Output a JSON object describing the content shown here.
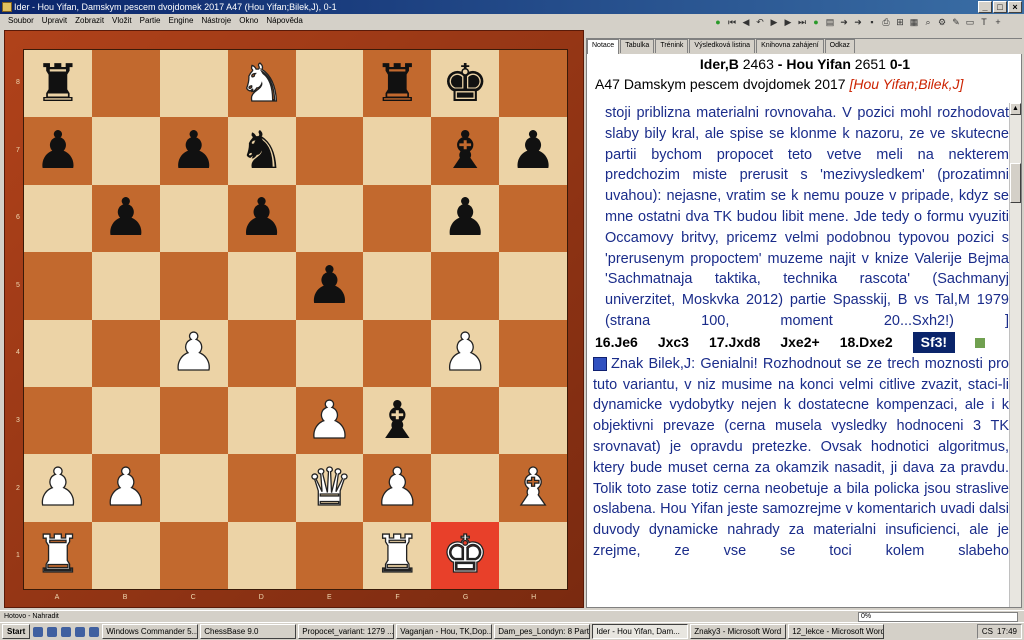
{
  "window": {
    "title": "Ider - Hou Yifan, Damskym pescem dvojdomek 2017  A47  (Hou Yifan;Bilek,J), 0-1"
  },
  "menu": [
    "Soubor",
    "Upravit",
    "Zobrazit",
    "Vložit",
    "Partie",
    "Engine",
    "Nástroje",
    "Okno",
    "Nápověda"
  ],
  "toolbar_icons": [
    "green-go-icon",
    "first-icon",
    "prev-icon",
    "undo-icon",
    "play-icon",
    "next-icon",
    "last-icon",
    "green-go-icon",
    "doc-icon",
    "arrow-icon",
    "arrow-icon",
    "save-icon",
    "print-icon",
    "tree-icon",
    "db-icon",
    "find-icon",
    "engine-icon",
    "edit-icon",
    "clipboard-icon",
    "text-icon",
    "plus-icon"
  ],
  "board": {
    "ranks": [
      "8",
      "7",
      "6",
      "5",
      "4",
      "3",
      "2",
      "1"
    ],
    "files": [
      "A",
      "B",
      "C",
      "D",
      "E",
      "F",
      "G",
      "H"
    ],
    "rows": [
      [
        "r",
        "",
        "",
        "N",
        "",
        "r",
        "k",
        ""
      ],
      [
        "p",
        "",
        "p",
        "n",
        "",
        "",
        "b",
        "p"
      ],
      [
        "",
        "p",
        "",
        "p",
        "",
        "",
        "p",
        ""
      ],
      [
        "",
        "",
        "",
        "",
        "p",
        "",
        "",
        ""
      ],
      [
        "",
        "",
        "P",
        "",
        "",
        "",
        "P",
        ""
      ],
      [
        "",
        "",
        "",
        "",
        "P",
        "b",
        "",
        ""
      ],
      [
        "P",
        "P",
        "",
        "",
        "Q",
        "P",
        "",
        "B"
      ],
      [
        "R",
        "",
        "",
        "",
        "",
        "R",
        "K",
        ""
      ]
    ],
    "highlight": "g1"
  },
  "tabs": [
    "Notace",
    "Tabulka",
    "Trénink",
    "Výsledková listina",
    "Knihovna zahájení",
    "Odkaz"
  ],
  "game": {
    "white": "Ider,B",
    "white_elo": "2463",
    "sep": "-",
    "black": "Hou Yifan",
    "black_elo": "2651",
    "result": "0-1",
    "eco": "A47",
    "event": "Damskym pescem dvojdomek 2017",
    "annotators": "[Hou Yifan;Bilek,J]"
  },
  "notes": {
    "para1": "stoji priblizna materialni rovnovaha. V pozici mohl rozhodovat slaby bily kral, ale spise se klonme k nazoru, ze ve skutecne partii bychom propocet teto vetve meli na nekterem predchozim miste prerusit s 'mezivysledkem' (prozatimni uvahou): nejasne, vratim se k nemu pouze v pripade, kdyz se mne ostatni dva TK budou libit  mene. Jde tedy o formu vyuziti Occamovy britvy, pricemz velmi podobnou typovou pozici s 'prerusenym propoctem' muzeme najit v knize Valerije Bejma 'Sachmatnaja taktika, technika rascota' (Sachmanyj univerzitet, Moskvka 2012) partie Spasskij, B vs Tal,M 1979 (strana 100, moment 20...Sxh2!) ]",
    "moves": [
      "16.Je6",
      "Jxc3",
      "17.Jxd8",
      "Jxe2+",
      "18.Dxe2"
    ],
    "current_move": "Sf3!",
    "para2": "Znak Bilek,J: Genialni! Rozhodnout se ze trech moznosti pro tuto variantu, v niz musime na konci velmi citlive zvazit, staci-li dynamicke vydobytky nejen k dostatecne kompenzaci, ale i k objektivni prevaze (cerna musela vysledky hodnoceni 3 TK srovnavat) je opravdu pretezke. Ovsak hodnotici algoritmus, ktery bude muset cerna za okamzik nasadit, ji dava za pravdu. Tolik toto zase totiz cerna neobetuje a bila policka jsou straslive oslabena. Hou Yifan jeste samozrejme v komentarich uvadi dalsi duvody dynamicke nahrady za materialni insuficienci, ale je zrejme, ze vse se toci kolem slabeho"
  },
  "status": {
    "text": "Hotovo - Nahradit",
    "progress": "0%"
  },
  "taskbar": {
    "start": "Start",
    "tasks": [
      "Windows Commander 5....",
      "ChessBase 9.0",
      "Propocet_variant: 1279 ...",
      "Vaganjan - Hou, TK,Dop...",
      "Dam_pes_Londyn: 8 Partie",
      "Ider - Hou Yifan, Dam...",
      "Znaky3 - Microsoft Word",
      "12_lekce - Microsoft Word"
    ],
    "active_index": 5,
    "lang": "CS",
    "clock": "17:49"
  }
}
